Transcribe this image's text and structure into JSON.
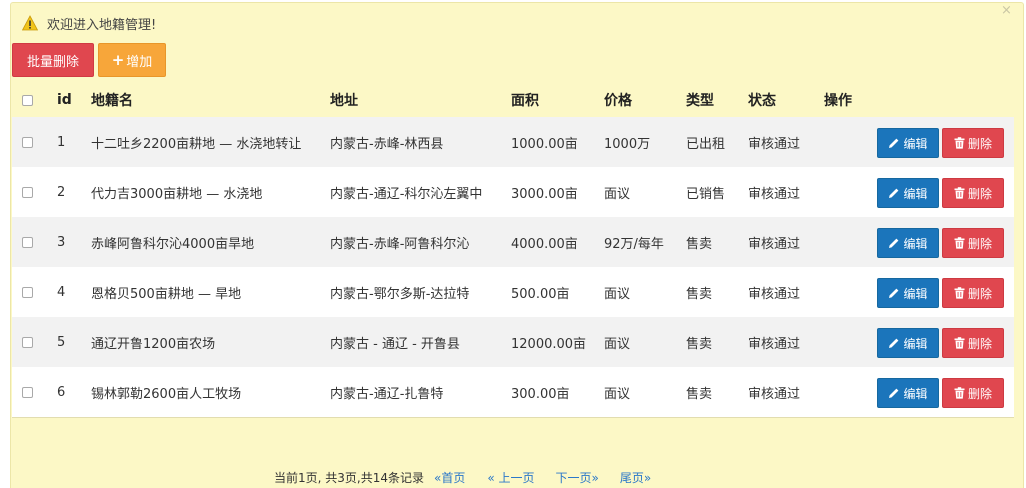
{
  "alert": {
    "message": "欢迎进入地籍管理!",
    "icon": "warning-icon"
  },
  "toolbar": {
    "batch_delete_label": "批量删除",
    "add_label": "增加",
    "add_icon": "+"
  },
  "table": {
    "headers": {
      "id": "id",
      "name": "地籍名",
      "address": "地址",
      "area": "面积",
      "price": "价格",
      "type": "类型",
      "status": "状态",
      "action": "操作"
    },
    "edit_label": "编辑",
    "delete_label": "删除",
    "rows": [
      {
        "id": "1",
        "name": "十二吐乡2200亩耕地 — 水浇地转让",
        "address": "内蒙古-赤峰-林西县",
        "area": "1000.00亩",
        "price": "1000万",
        "type": "已出租",
        "status": "审核通过"
      },
      {
        "id": "2",
        "name": "代力吉3000亩耕地 — 水浇地",
        "address": "内蒙古-通辽-科尔沁左翼中",
        "area": "3000.00亩",
        "price": "面议",
        "type": "已销售",
        "status": "审核通过"
      },
      {
        "id": "3",
        "name": "赤峰阿鲁科尔沁4000亩旱地",
        "address": "内蒙古-赤峰-阿鲁科尔沁",
        "area": "4000.00亩",
        "price": "92万/每年",
        "type": "售卖",
        "status": "审核通过"
      },
      {
        "id": "4",
        "name": "恩格贝500亩耕地 — 旱地",
        "address": "内蒙古-鄂尔多斯-达拉特",
        "area": "500.00亩",
        "price": "面议",
        "type": "售卖",
        "status": "审核通过"
      },
      {
        "id": "5",
        "name": "通辽开鲁1200亩农场",
        "address": "内蒙古 - 通辽 - 开鲁县",
        "area": "12000.00亩",
        "price": "面议",
        "type": "售卖",
        "status": "审核通过"
      },
      {
        "id": "6",
        "name": "锡林郭勒2600亩人工牧场",
        "address": "内蒙古-通辽-扎鲁特",
        "area": "300.00亩",
        "price": "面议",
        "type": "售卖",
        "status": "审核通过"
      }
    ]
  },
  "pagination": {
    "summary": "当前1页, 共3页,共14条记录",
    "first": "«首页",
    "prev": "« 上一页",
    "next": "下一页»",
    "last": "尾页»"
  },
  "colors": {
    "panel_bg": "#fcf8c6",
    "danger": "#e0474f",
    "warning": "#f7a63a",
    "primary": "#1b75bb",
    "link": "#2a77c9"
  }
}
